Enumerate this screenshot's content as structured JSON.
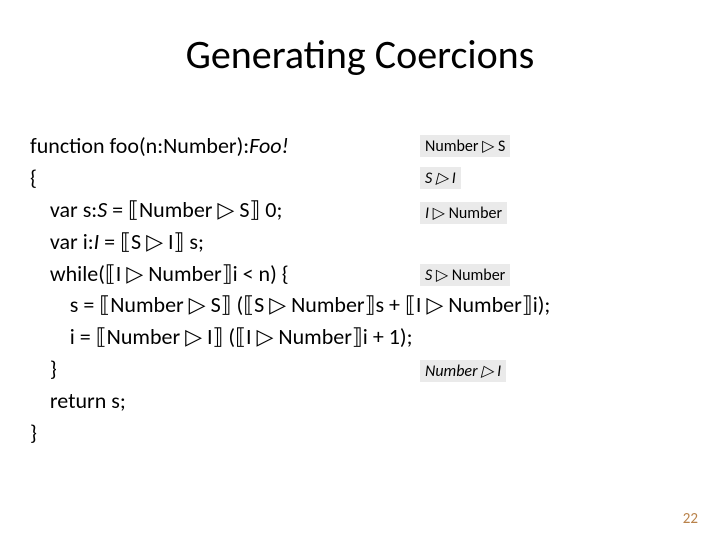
{
  "title": "Generating Coercions",
  "code": {
    "l1a": "function foo(n:Number):",
    "l1b": "Foo!",
    "l2": "{",
    "l3a": "    var s:",
    "l3b": "S",
    "l3c": " = ⟦Number ▷ S⟧ 0;",
    "l4a": "    var i:",
    "l4b": "I",
    "l4c": " = ⟦S ▷ I⟧ s;",
    "l5": "    while(⟦I ▷ Number⟧i < n) {",
    "l6": "        s = ⟦Number ▷ S⟧ (⟦S ▷ Number⟧s + ⟦I ▷ Number⟧i);",
    "l7": "        i = ⟦Number ▷ I⟧ (⟦I ▷ Number⟧i + 1);",
    "l8": "    }",
    "l9": "    return s;",
    "l10": "}"
  },
  "annotations": {
    "a1": "Number ▷ S",
    "a2": "S ▷ I",
    "a3": "I ▷ Number",
    "a4": "S ▷ Number",
    "a5": "Number ▷ I"
  },
  "page_number": "22"
}
